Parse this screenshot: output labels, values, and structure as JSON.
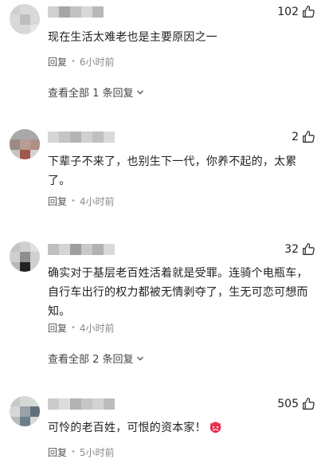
{
  "comments": [
    {
      "likes": "102",
      "text": "现在生活太难老也是主要原因之一",
      "reply_label": "回复",
      "time": "6小时前",
      "view_all": "查看全部 1 条回复"
    },
    {
      "likes": "2",
      "text": "下辈子不来了，也别生下一代，你养不起的，太累了。",
      "reply_label": "回复",
      "time": "4小时前"
    },
    {
      "likes": "32",
      "text": "确实对于基层老百姓活着就是受罪。连骑个电瓶车，自行车出行的权力都被无情剥夺了，生无可恋可想而知。",
      "reply_label": "回复",
      "time": "4小时前",
      "view_all": "查看全部 2 条回复"
    },
    {
      "likes": "505",
      "text": "可怜的老百姓，可恨的资本家！",
      "reply_label": "回复",
      "time": "5小时前"
    }
  ],
  "icons": {
    "like": "thumbs-up-icon",
    "expand": "chevron-down-icon",
    "emoji": "angry-face-emoji"
  },
  "colors": {
    "text": "#222222",
    "meta": "#8a8a8a",
    "emoji": "#e8314f"
  }
}
